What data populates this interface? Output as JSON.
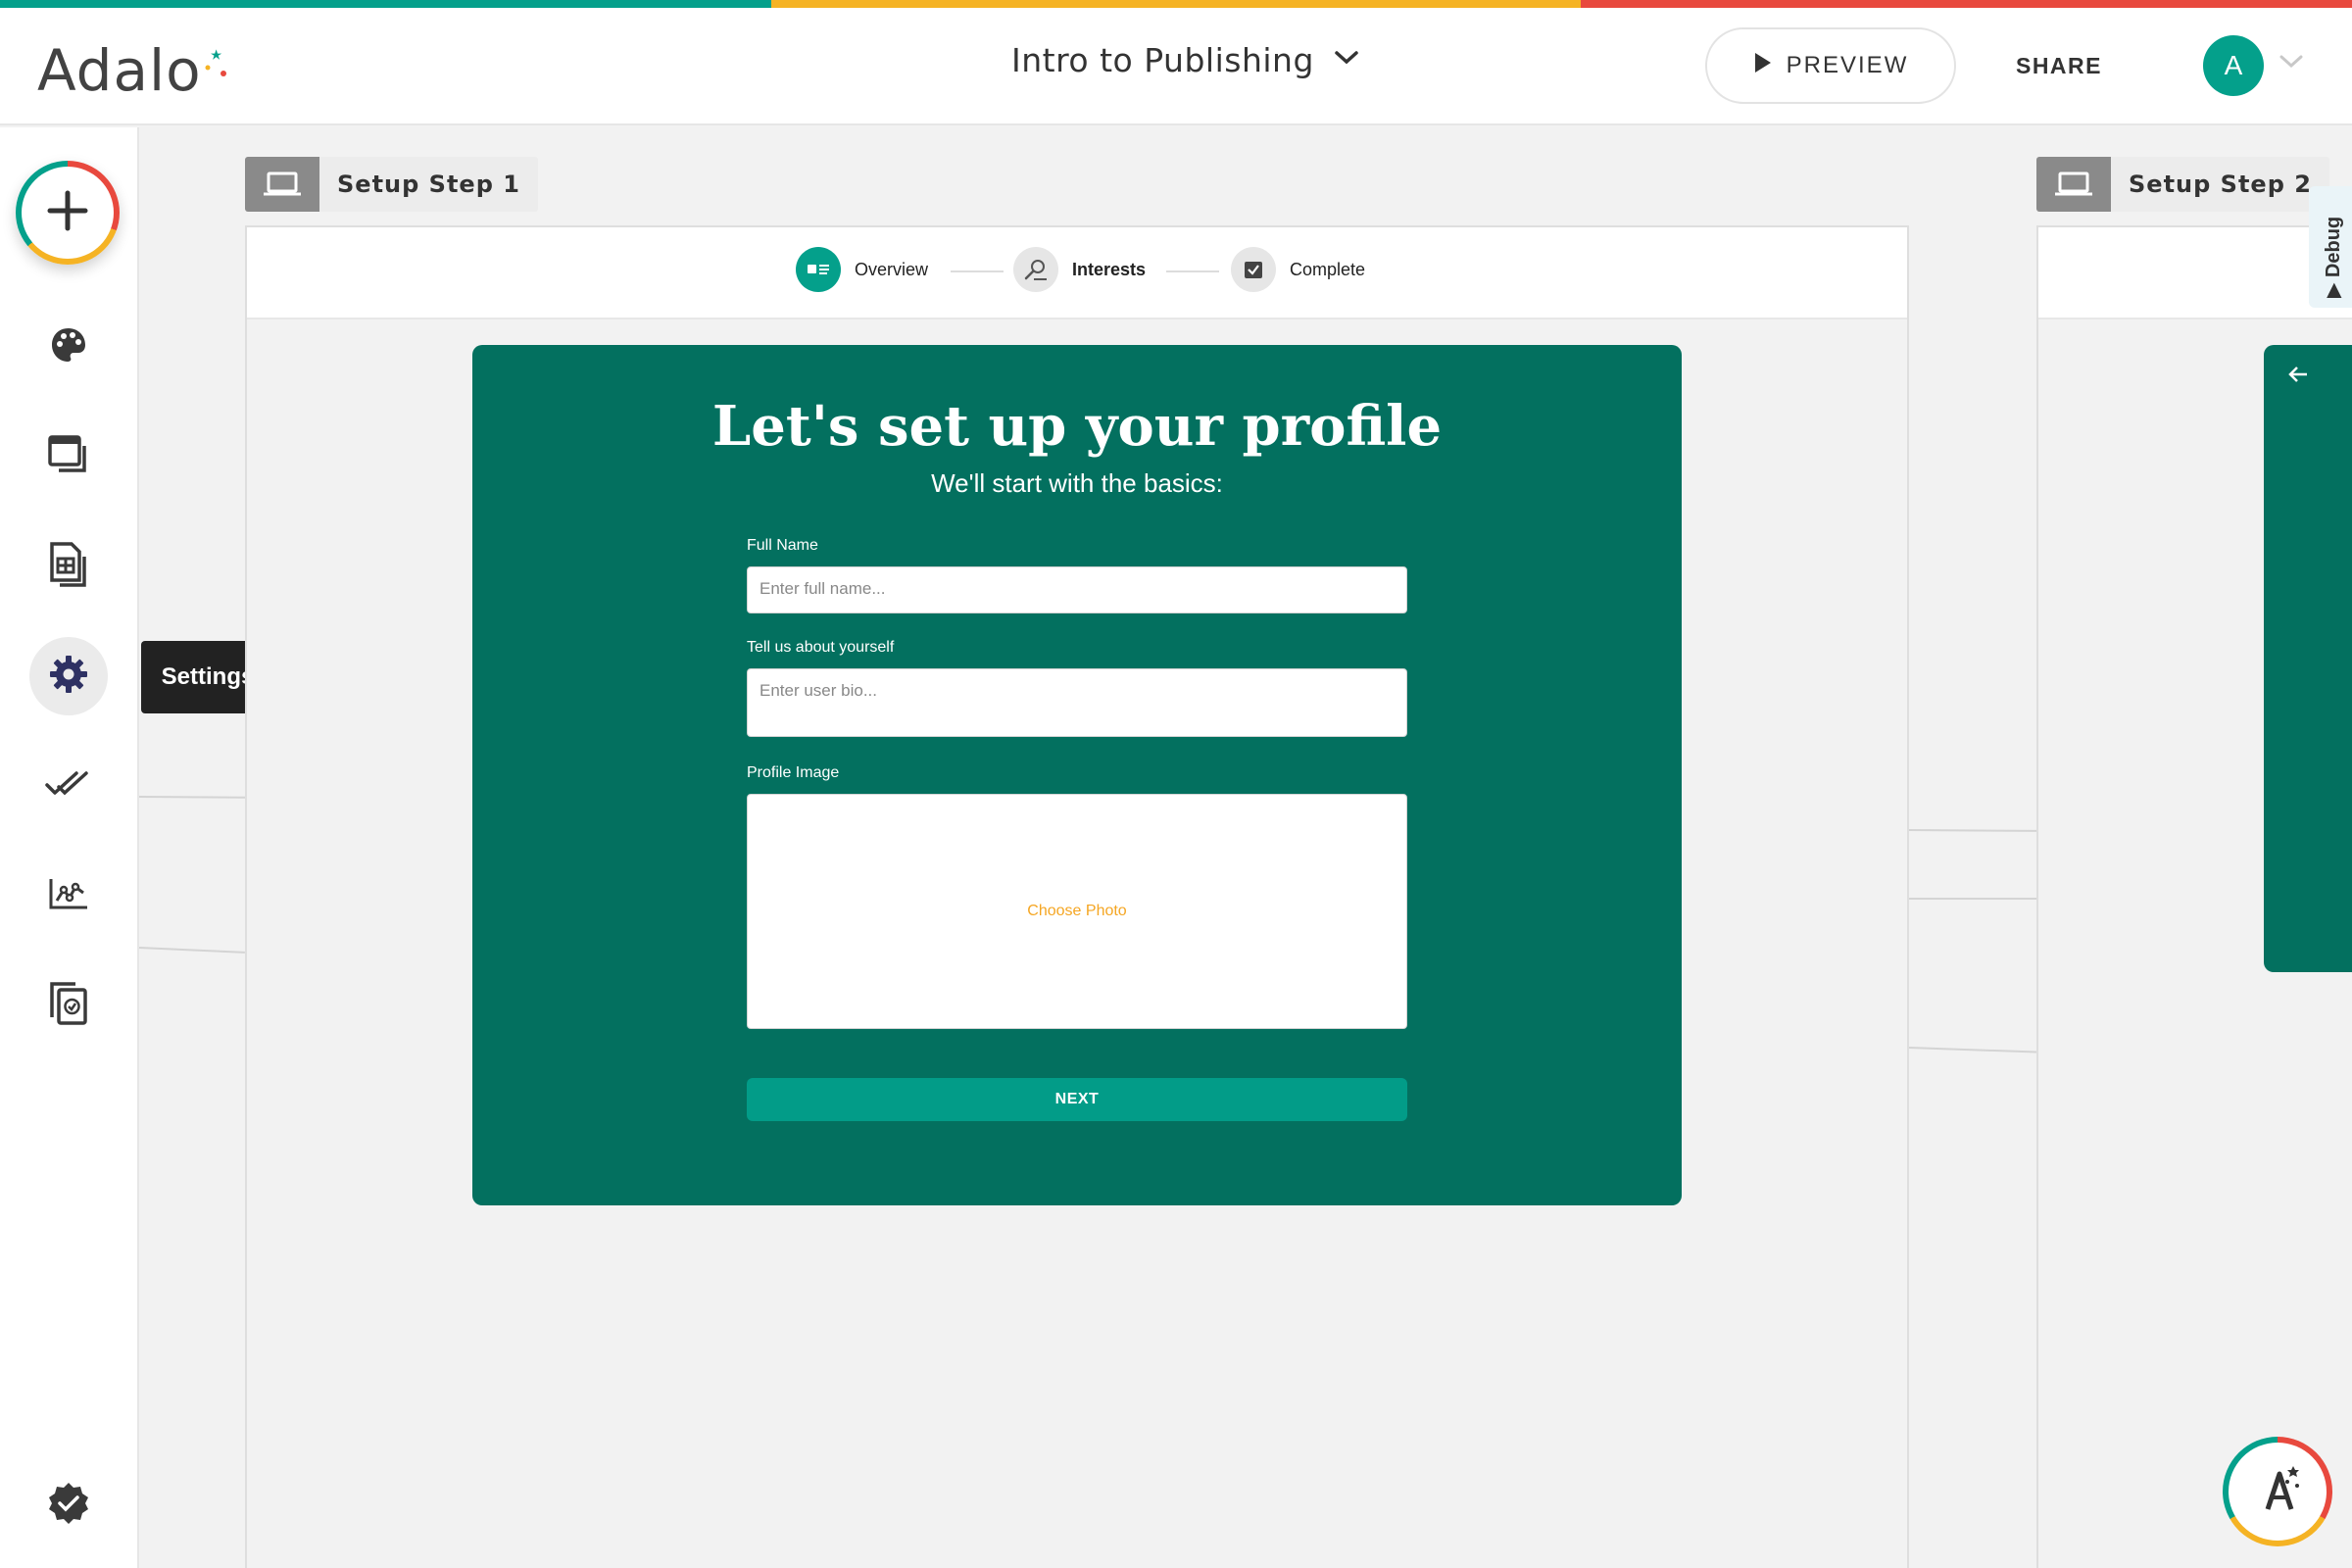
{
  "app": {
    "logo_text": "Adalo",
    "project_title": "Intro to Publishing"
  },
  "header": {
    "preview_label": "PREVIEW",
    "share_label": "SHARE",
    "avatar_initial": "A"
  },
  "sidebar": {
    "items": [
      {
        "icon": "add-icon",
        "label": "Add"
      },
      {
        "icon": "palette-icon",
        "label": "Branding"
      },
      {
        "icon": "screens-icon",
        "label": "Screens"
      },
      {
        "icon": "database-icon",
        "label": "Database"
      },
      {
        "icon": "gear-icon",
        "label": "Settings",
        "active": true
      },
      {
        "icon": "double-check-icon",
        "label": "Publish"
      },
      {
        "icon": "analytics-icon",
        "label": "Analytics"
      },
      {
        "icon": "copy-check-icon",
        "label": "Versions"
      },
      {
        "icon": "verified-badge-icon",
        "label": "Checklist"
      }
    ],
    "tooltip": "Settings"
  },
  "canvas": {
    "screen1": {
      "label": "Setup Step 1",
      "stepper": [
        {
          "label": "Overview",
          "icon": "card-icon",
          "state": "active"
        },
        {
          "label": "Interests",
          "icon": "search-person-icon",
          "state": "pending"
        },
        {
          "label": "Complete",
          "icon": "checkbox-icon",
          "state": "pending"
        }
      ],
      "form": {
        "title": "Let's set up your profile",
        "subtitle": "We'll start with the basics:",
        "full_name_label": "Full Name",
        "full_name_placeholder": "Enter full name...",
        "bio_label": "Tell us about yourself",
        "bio_placeholder": "Enter user bio...",
        "image_label": "Profile Image",
        "choose_photo": "Choose Photo",
        "next_label": "NEXT"
      }
    },
    "screen2": {
      "label": "Setup Step 2"
    },
    "debug_label": "Debug"
  },
  "colors": {
    "brand_teal": "#04a08b",
    "card_green": "#03705f",
    "accent_yellow": "#f5b324",
    "accent_red": "#e8493e"
  }
}
